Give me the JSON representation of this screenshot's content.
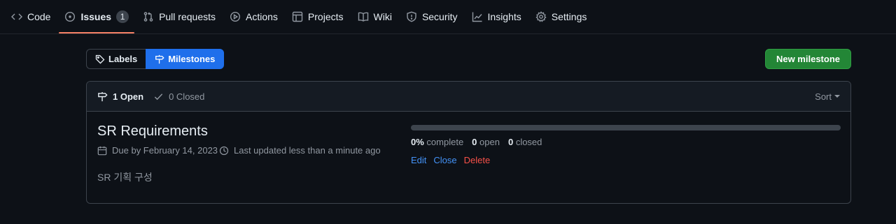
{
  "nav": {
    "items": [
      {
        "label": "Code",
        "icon": "code-icon"
      },
      {
        "label": "Issues",
        "icon": "issue-opened-icon",
        "count": "1"
      },
      {
        "label": "Pull requests",
        "icon": "git-pull-request-icon"
      },
      {
        "label": "Actions",
        "icon": "play-icon"
      },
      {
        "label": "Projects",
        "icon": "table-icon"
      },
      {
        "label": "Wiki",
        "icon": "book-icon"
      },
      {
        "label": "Security",
        "icon": "shield-icon"
      },
      {
        "label": "Insights",
        "icon": "graph-icon"
      },
      {
        "label": "Settings",
        "icon": "gear-icon"
      }
    ],
    "selected": "Issues"
  },
  "subnav": {
    "labels": "Labels",
    "milestones": "Milestones"
  },
  "new_milestone_label": "New milestone",
  "states": {
    "open": "1 Open",
    "closed": "0 Closed"
  },
  "sort_label": "Sort",
  "milestone": {
    "title": "SR Requirements",
    "due": "Due by February 14, 2023",
    "updated": "Last updated less than a minute ago",
    "description": "SR 기획 구성",
    "progress_fraction": 0,
    "complete_value": "0%",
    "complete_label": "complete",
    "open_value": "0",
    "open_label": "open",
    "closed_value": "0",
    "closed_label": "closed",
    "actions": {
      "edit": "Edit",
      "close": "Close",
      "delete": "Delete"
    }
  },
  "colors": {
    "background": "#0d1117",
    "accent_underline": "#f78166",
    "primary_button": "#238636",
    "selected_tab": "#1f6feb",
    "link": "#4493f8",
    "danger": "#f85149"
  }
}
